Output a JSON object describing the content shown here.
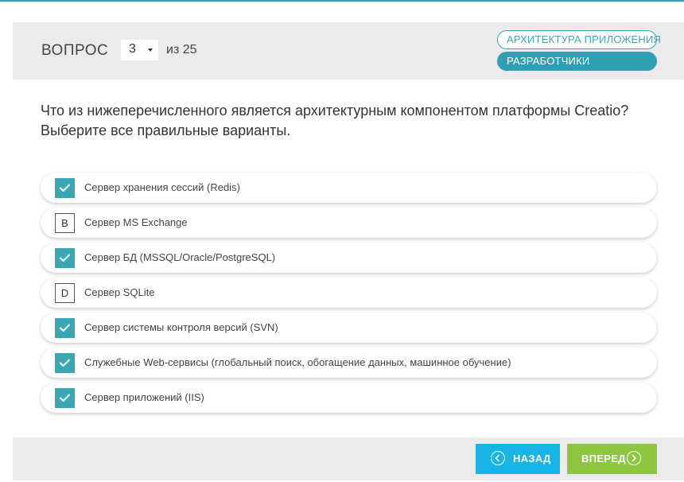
{
  "header": {
    "question_label": "ВОПРОС",
    "current_question": "3",
    "total_text": "из 25",
    "tags": [
      "АРХИТЕКТУРА ПРИЛОЖЕНИЯ",
      "РАЗРАБОТЧИКИ"
    ]
  },
  "question": {
    "text": "Что из нижеперечисленного является архитектурным компонентом платформы Creatio? Выберите все правильные варианты."
  },
  "options": [
    {
      "marker": "",
      "checked": true,
      "text": "Сервер хранения сессий (Redis)"
    },
    {
      "marker": "B",
      "checked": false,
      "text": "Сервер MS Exchange"
    },
    {
      "marker": "",
      "checked": true,
      "text": "Сервер БД (MSSQL/Oracle/PostgreSQL)"
    },
    {
      "marker": "D",
      "checked": false,
      "text": "Сервер SQLite"
    },
    {
      "marker": "",
      "checked": true,
      "text": "Сервер системы контроля версий (SVN)"
    },
    {
      "marker": "",
      "checked": true,
      "text": "Служебные Web-сервисы (глобальный поиск, обогащение данных, машинное обучение)"
    },
    {
      "marker": "",
      "checked": true,
      "text": "Сервер приложений (IIS)"
    }
  ],
  "footer": {
    "back_label": "НАЗАД",
    "next_label": "ВПЕРЕД"
  },
  "icons": {
    "check": "check-icon",
    "back": "chevron-left-circle-icon",
    "next": "chevron-right-circle-icon",
    "dropdown": "caret-down-icon"
  },
  "colors": {
    "accent": "#2f9fb1",
    "back_button": "#17b4e6",
    "next_button": "#8dc63f",
    "panel": "#ebebeb"
  }
}
